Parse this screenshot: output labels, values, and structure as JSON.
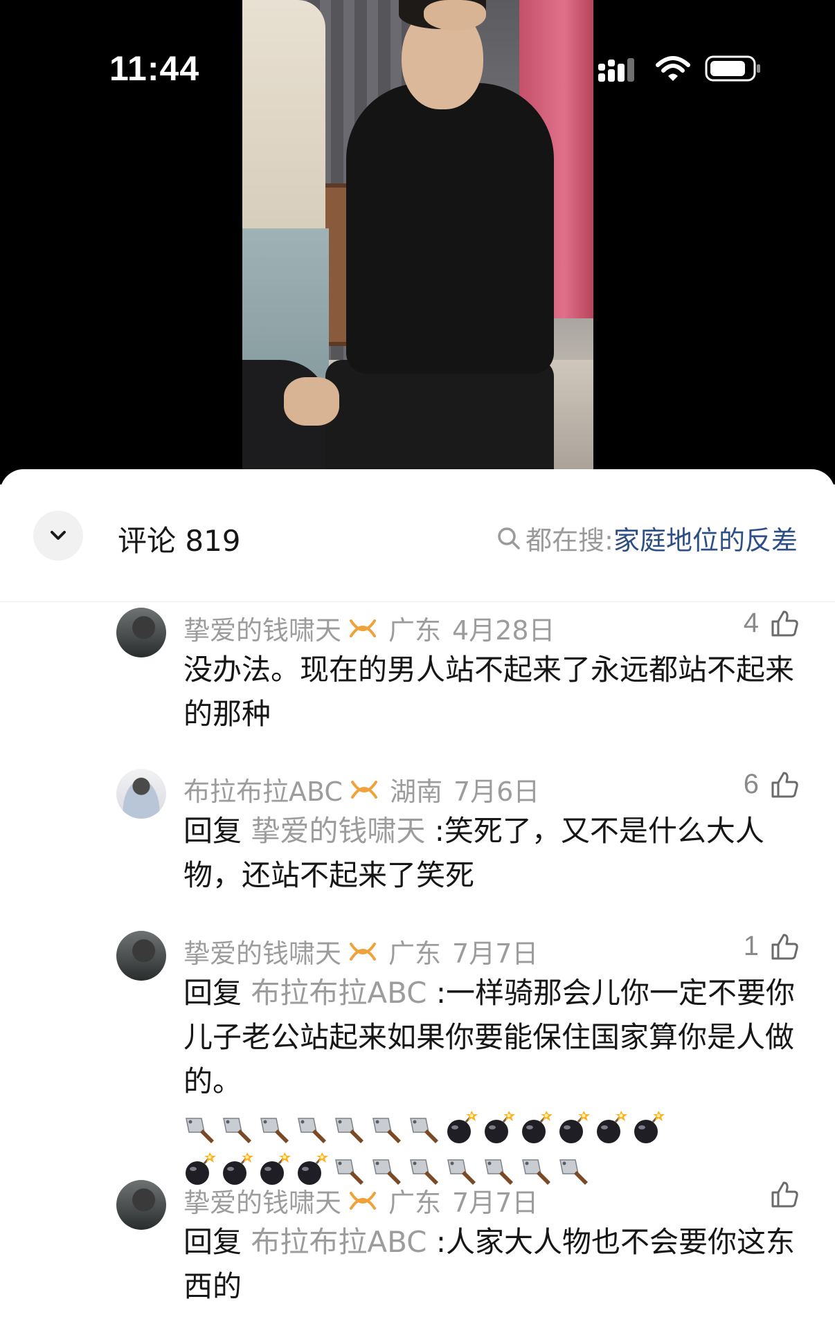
{
  "status_bar": {
    "time": "11:44",
    "icons": [
      "signal-icon",
      "wifi-icon",
      "battery-icon"
    ]
  },
  "comments_header": {
    "title": "评论 819",
    "search_prefix": "都在搜:",
    "search_term": "家庭地位的反差"
  },
  "colors": {
    "accent_link": "#2e4f86",
    "muted_text": "#9c9c9c",
    "badge_gold": "#f0a23a"
  },
  "comments": [
    {
      "username": "挚爱的钱啸天",
      "location": "广东",
      "date": "4月28日",
      "likes": "4",
      "reply_word": "",
      "reply_target": "",
      "text": "没办法。现在的男人站不起来了永远都站不起来的那种"
    },
    {
      "username": "布拉布拉ABC",
      "location": "湖南",
      "date": "7月6日",
      "likes": "6",
      "reply_word": "回复",
      "reply_target": "挚爱的钱啸天",
      "text": ":笑死了，又不是什么大人物，还站不起来了笑死"
    },
    {
      "username": "挚爱的钱啸天",
      "location": "广东",
      "date": "7月7日",
      "likes": "1",
      "reply_word": "回复",
      "reply_target": "布拉布拉ABC",
      "text": ":一样骑那会儿你一定不要你儿子老公站起来如果你要能保住国家算你是人做的。",
      "emoji_line1": [
        "cleaver",
        "cleaver",
        "cleaver",
        "cleaver",
        "cleaver",
        "cleaver",
        "cleaver",
        "bomb",
        "bomb",
        "bomb",
        "bomb",
        "bomb",
        "bomb"
      ],
      "emoji_line2": [
        "bomb",
        "bomb",
        "bomb",
        "bomb",
        "cleaver",
        "cleaver",
        "cleaver",
        "cleaver",
        "cleaver",
        "cleaver",
        "cleaver"
      ]
    },
    {
      "username": "挚爱的钱啸天",
      "location": "广东",
      "date": "7月7日",
      "likes": "",
      "reply_word": "回复",
      "reply_target": "布拉布拉ABC",
      "text": ":人家大人物也不会要你这东西的"
    }
  ]
}
